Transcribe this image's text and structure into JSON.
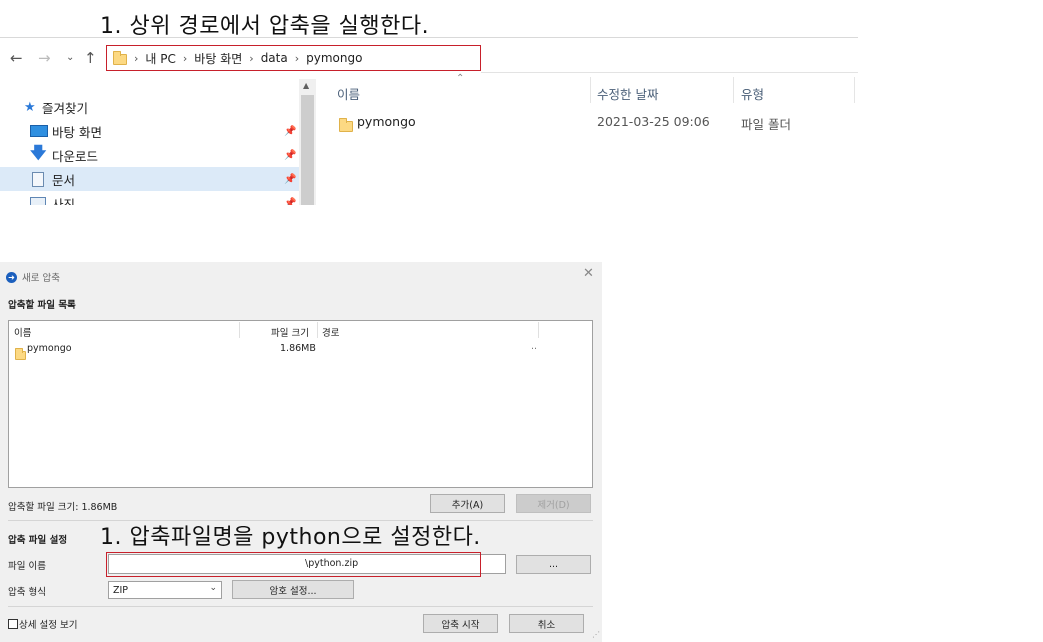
{
  "annotations": {
    "top_note": "1.  상위 경로에서 압축을 실행한다.",
    "mid_note": "1.  압축파일명을 python으로 설정한다."
  },
  "explorer": {
    "breadcrumb": [
      "내 PC",
      "바탕 화면",
      "data",
      "pymongo"
    ],
    "sidebar": [
      {
        "label": "즐겨찾기",
        "icon": "star-icon"
      },
      {
        "label": "바탕 화면",
        "icon": "desktop-icon"
      },
      {
        "label": "다운로드",
        "icon": "download-icon"
      },
      {
        "label": "문서",
        "icon": "document-icon"
      },
      {
        "label": "사진",
        "icon": "picture-icon"
      }
    ],
    "columns": [
      "이름",
      "수정한 날짜",
      "유형"
    ],
    "rows": [
      {
        "name": "pymongo",
        "modified": "2021-03-25 09:06",
        "type": "파일 폴더"
      }
    ]
  },
  "dialog": {
    "title": "새로 압축",
    "file_list_label": "압축할 파일 목록",
    "list_columns": [
      "이름",
      "파일 크기",
      "경로"
    ],
    "list_rows": [
      {
        "name": "pymongo",
        "size": "1.86MB",
        "path": ".."
      }
    ],
    "total_size": "압축할 파일 크기: 1.86MB",
    "add_button": "추가(A)",
    "remove_button": "제거(D)",
    "settings_label": "압축 파일 설정",
    "filename_label": "파일 이름",
    "filename_value": "\\python.zip",
    "browse_button": "...",
    "format_label": "압축 형식",
    "format_value": "ZIP",
    "password_button": "암호 설정...",
    "advanced_label": "상세 설정 보기",
    "start_button": "압축 시작",
    "cancel_button": "취소"
  }
}
